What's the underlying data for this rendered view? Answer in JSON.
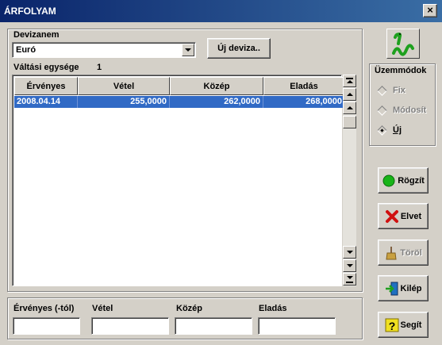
{
  "window": {
    "title": "ÁRFOLYAM",
    "close_glyph": "×"
  },
  "currency": {
    "label": "Devizanem",
    "selected": "Euró",
    "new_button": "Új deviza..",
    "exchange_unit_label": "Váltási egysége",
    "exchange_unit_value": "1"
  },
  "grid": {
    "columns": [
      "Érvényes",
      "Vétel",
      "Közép",
      "Eladás"
    ],
    "rows": [
      {
        "date": "2008.04.14",
        "buy": "255,0000",
        "mid": "262,0000",
        "sell": "268,0000"
      }
    ]
  },
  "entry": {
    "valid_from_label": "Érvényes (-tól)",
    "buy_label": "Vétel",
    "mid_label": "Közép",
    "sell_label": "Eladás",
    "valid_from_value": "",
    "buy_value": "",
    "mid_value": "",
    "sell_value": ""
  },
  "modes": {
    "title": "Üzemmódok",
    "items": [
      {
        "label": "Fix",
        "selected": false
      },
      {
        "label": "Módosít",
        "selected": false
      },
      {
        "label": "Új",
        "selected": true
      }
    ]
  },
  "actions": {
    "save": "Rögzít",
    "discard": "Elvet",
    "delete": "Töröl",
    "exit": "Kilép",
    "help": "Segít"
  },
  "colors": {
    "title_bar": "#0a246a",
    "selection": "#316ac5",
    "face": "#d4d0c8"
  },
  "icons": [
    "worm-logo-icon",
    "green-circle-icon",
    "red-x-icon",
    "broom-icon",
    "exit-door-icon",
    "question-icon"
  ]
}
